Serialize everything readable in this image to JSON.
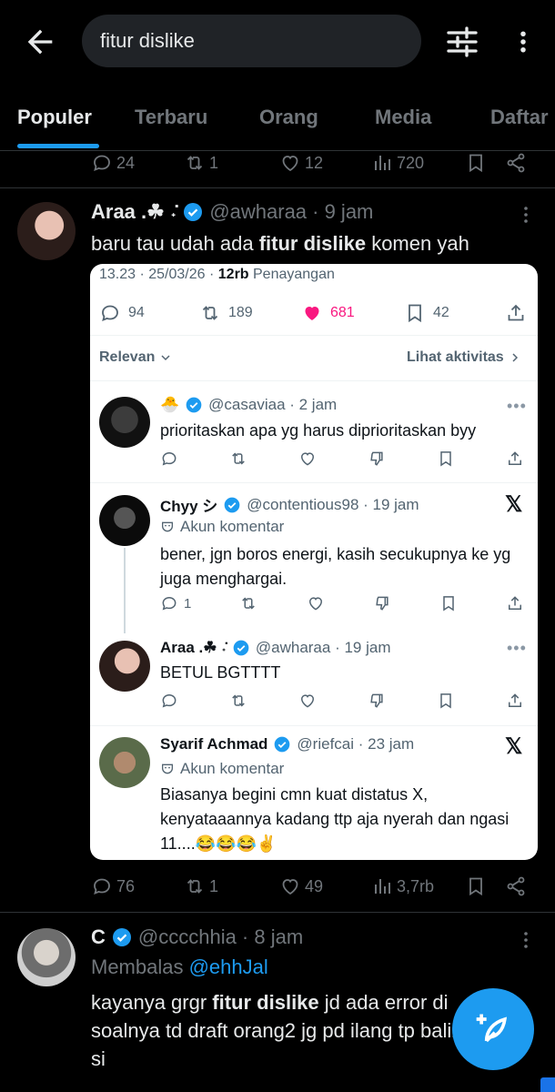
{
  "search": {
    "query": "fitur dislike"
  },
  "tabs": [
    "Populer",
    "Terbaru",
    "Orang",
    "Media",
    "Daftar"
  ],
  "prev_tweet_actions": {
    "replies": "24",
    "retweets": "1",
    "likes": "12",
    "views": "720"
  },
  "tweet1": {
    "name": "Araa .⁠☘︎ ݁˖",
    "handle": "@awharaa · 9 jam",
    "text_pre": "baru tau udah ada ",
    "text_bold": "fitur dislike",
    "text_post": " komen yah",
    "actions": {
      "replies": "76",
      "retweets": "1",
      "likes": "49",
      "views": "3,7rb"
    }
  },
  "card": {
    "meta_date": "13.23 · 25/03/26 · ",
    "meta_views": "12rb",
    "meta_suffix": " Penayangan",
    "stats": {
      "replies": "94",
      "retweets": "189",
      "likes": "681",
      "bookmarks": "42"
    },
    "sort_label": "Relevan",
    "activity_label": "Lihat aktivitas",
    "comments": [
      {
        "name": "🐣",
        "handle": "@casaviaa · 2 jam",
        "text": "prioritaskan apa yg harus diprioritaskan byy",
        "replies": ""
      },
      {
        "name": "Chyy シ",
        "handle": "@contentious98 · 19 jam",
        "sub": "Akun komentar",
        "text": "bener, jgn boros energi, kasih secukupnya ke yg juga menghargai.",
        "replies": "1"
      },
      {
        "name": "Araa .⁠☘︎ ݁˖",
        "handle": "@awharaa · 19 jam",
        "text": "BETUL BGTTTT",
        "replies": ""
      },
      {
        "name": "Syarif Achmad",
        "handle": "@riefcai · 23 jam",
        "sub": "Akun komentar",
        "text": "Biasanya begini cmn kuat distatus X, kenyataaannya kadang ttp aja nyerah dan ngasi 11....😂😂😂✌️",
        "replies": ""
      }
    ]
  },
  "tweet2": {
    "name": "C",
    "handle": "@cccchhia · 8 jam",
    "reply_prefix": "Membalas ",
    "reply_to": "@ehhJal",
    "text_pre": "kayanya grgr ",
    "text_bold": "fitur dislike",
    "text_post": " jd ada error di soalnya td draft orang2 jg pd ilang tp balik si"
  },
  "colors": {
    "accent": "#1d9bf0",
    "like_pink": "#f91880",
    "verified": "#1d9bf0"
  }
}
